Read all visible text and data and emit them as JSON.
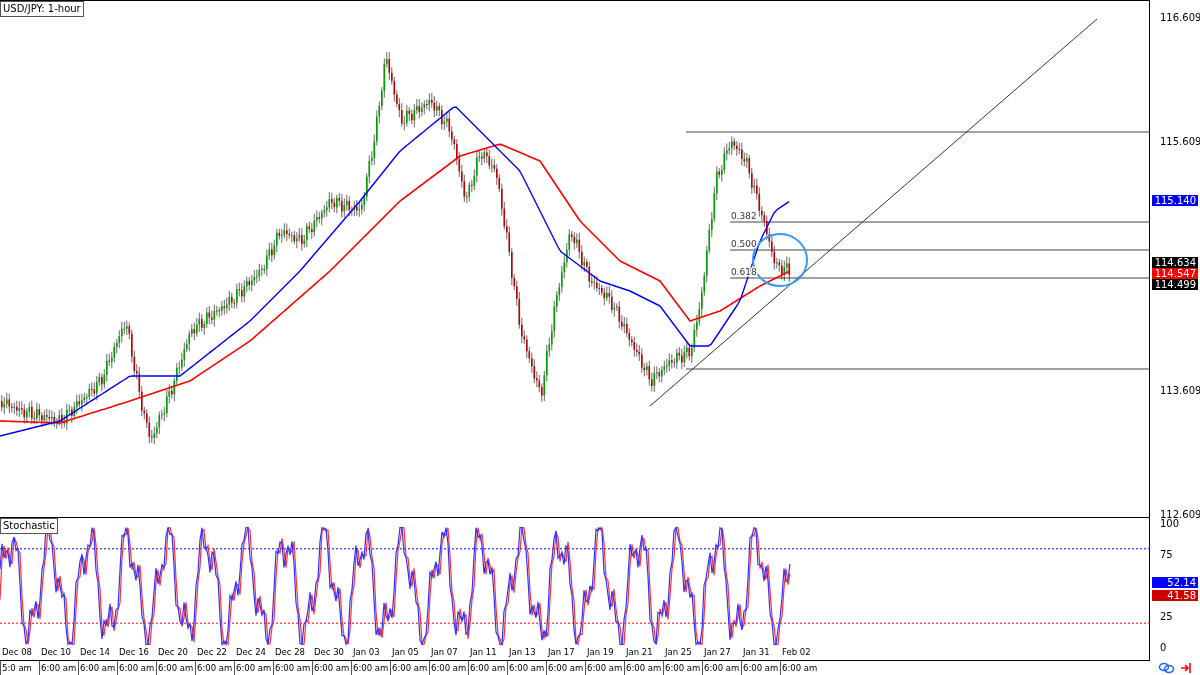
{
  "chart": {
    "title": "USD/JPY: 1-hour",
    "price_axis": [
      "116.609",
      "115.609",
      "113.609",
      "112.609"
    ],
    "fib_levels": [
      "0.382",
      "0.500",
      "0.618"
    ],
    "price_badges": [
      {
        "text": "115.140",
        "color": "#0000ff"
      },
      {
        "text": "114.634",
        "color": "#000000"
      },
      {
        "text": "114.547",
        "color": "#ff0000"
      },
      {
        "text": "114.499",
        "color": "#000000"
      }
    ]
  },
  "stochastic": {
    "title": "Stochastic",
    "axis": [
      "100",
      "75",
      "25",
      "0"
    ],
    "badges": [
      {
        "text": "52.14",
        "color": "#0000ff"
      },
      {
        "text": "41.58",
        "color": "#cc0000"
      }
    ]
  },
  "time_axis": {
    "dates": [
      "Dec 08",
      "Dec 10",
      "Dec 14",
      "Dec 16",
      "Dec 20",
      "Dec 22",
      "Dec 24",
      "Dec 28",
      "Dec 30",
      "Jan 03",
      "Jan 05",
      "Jan 07",
      "Jan 11",
      "Jan 13",
      "Jan 17",
      "Jan 19",
      "Jan 21",
      "Jan 25",
      "Jan 27",
      "Jan 31",
      "Feb 02"
    ],
    "times": [
      "5:0 am",
      "6:00 am",
      "6:00 am",
      "6:00 am",
      "6:00 am",
      "6:00 am",
      "6:00 am",
      "6:00 am",
      "6:00 am",
      "6:00 am",
      "6:00 am",
      "6:00 am",
      "6:00 am",
      "6:00 am",
      "6:00 am",
      "6:00 am",
      "6:00 am",
      "6:00 am",
      "6:00 am",
      "6:00 am",
      "6:00 am"
    ]
  }
}
